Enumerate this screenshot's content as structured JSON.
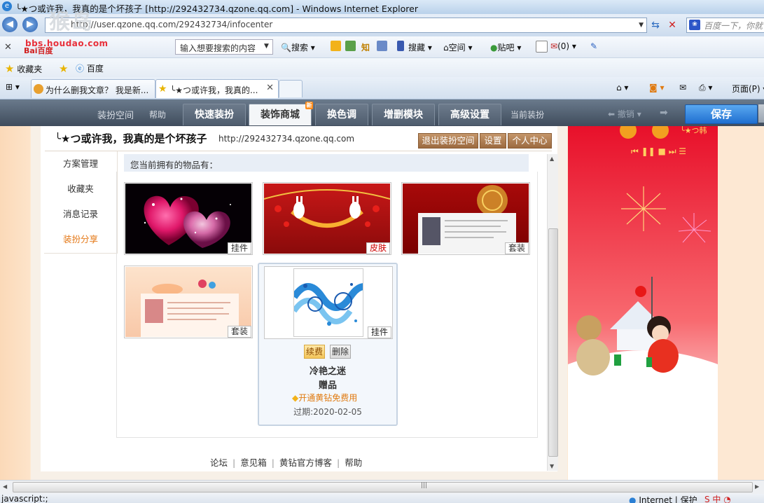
{
  "window": {
    "title": "╰★つ或许我，我真的是个坏孩子 [http://292432734.qzone.qq.com] - Windows Internet Explorer"
  },
  "address": {
    "url": "http://user.qzone.qq.com/292432734/infocenter",
    "search_placeholder": "百度一下，你就"
  },
  "baidu_toolbar": {
    "watermark_site": "bbs.houdao.com",
    "logo": "Bai百度",
    "search_hint": "输入想要搜索的内容",
    "search_label": "搜索",
    "know_label": "知",
    "collect_label": "搜藏",
    "space_label": "空间",
    "tieba_label": "贴吧",
    "count_label": "(0)"
  },
  "favorites_bar": {
    "favorites_label": "收藏夹",
    "baidu_label": "百度"
  },
  "tabs": [
    {
      "label": "为什么删我文章？ 我是新..."
    },
    {
      "label": "╰★つ或许我，我真的..."
    }
  ],
  "command_bar": {
    "page_label": "页面(P)"
  },
  "decor_toolbar": {
    "decor_space": "装扮空间",
    "help": "帮助",
    "tabs": [
      "快速装扮",
      "装饰商城",
      "换色调",
      "增删模块",
      "高级设置"
    ],
    "new_badge": "新",
    "current_decor": "当前装扮",
    "undo": "撤销",
    "save": "保存"
  },
  "header": {
    "title": "╰★つ或许我，我真的是个坏孩子",
    "url": "http://292432734.qzone.qq.com",
    "exit_button": "退出装扮空间",
    "settings_button": "设置",
    "personal_center_button": "个人中心"
  },
  "left_menu": {
    "items": [
      "方案管理",
      "收藏夹",
      "消息记录",
      "装扮分享"
    ]
  },
  "owned": {
    "heading": "您当前拥有的物品有："
  },
  "items": [
    {
      "tag": "挂件"
    },
    {
      "tag": "皮肤"
    },
    {
      "tag": "套装"
    },
    {
      "tag": "套装"
    }
  ],
  "selected_item": {
    "tag": "挂件",
    "renew": "续费",
    "delete": "删除",
    "name": "冷艳之迷",
    "gift": "赠品",
    "vip": "开通黄钻免费用",
    "expire": "过期:2020-02-05"
  },
  "footer": {
    "links": [
      "论坛",
      "意见箱",
      "黄钻官方博客",
      "帮助"
    ]
  },
  "right_decor": {
    "signature": "╰★つ韩"
  },
  "status": {
    "left": "javascript:;",
    "zone": "Internet | 保护"
  },
  "colors": {
    "accent_orange": "#e57a1a",
    "save_blue": "#1f6fd0",
    "toolbar_dark": "#4f5d6e"
  }
}
